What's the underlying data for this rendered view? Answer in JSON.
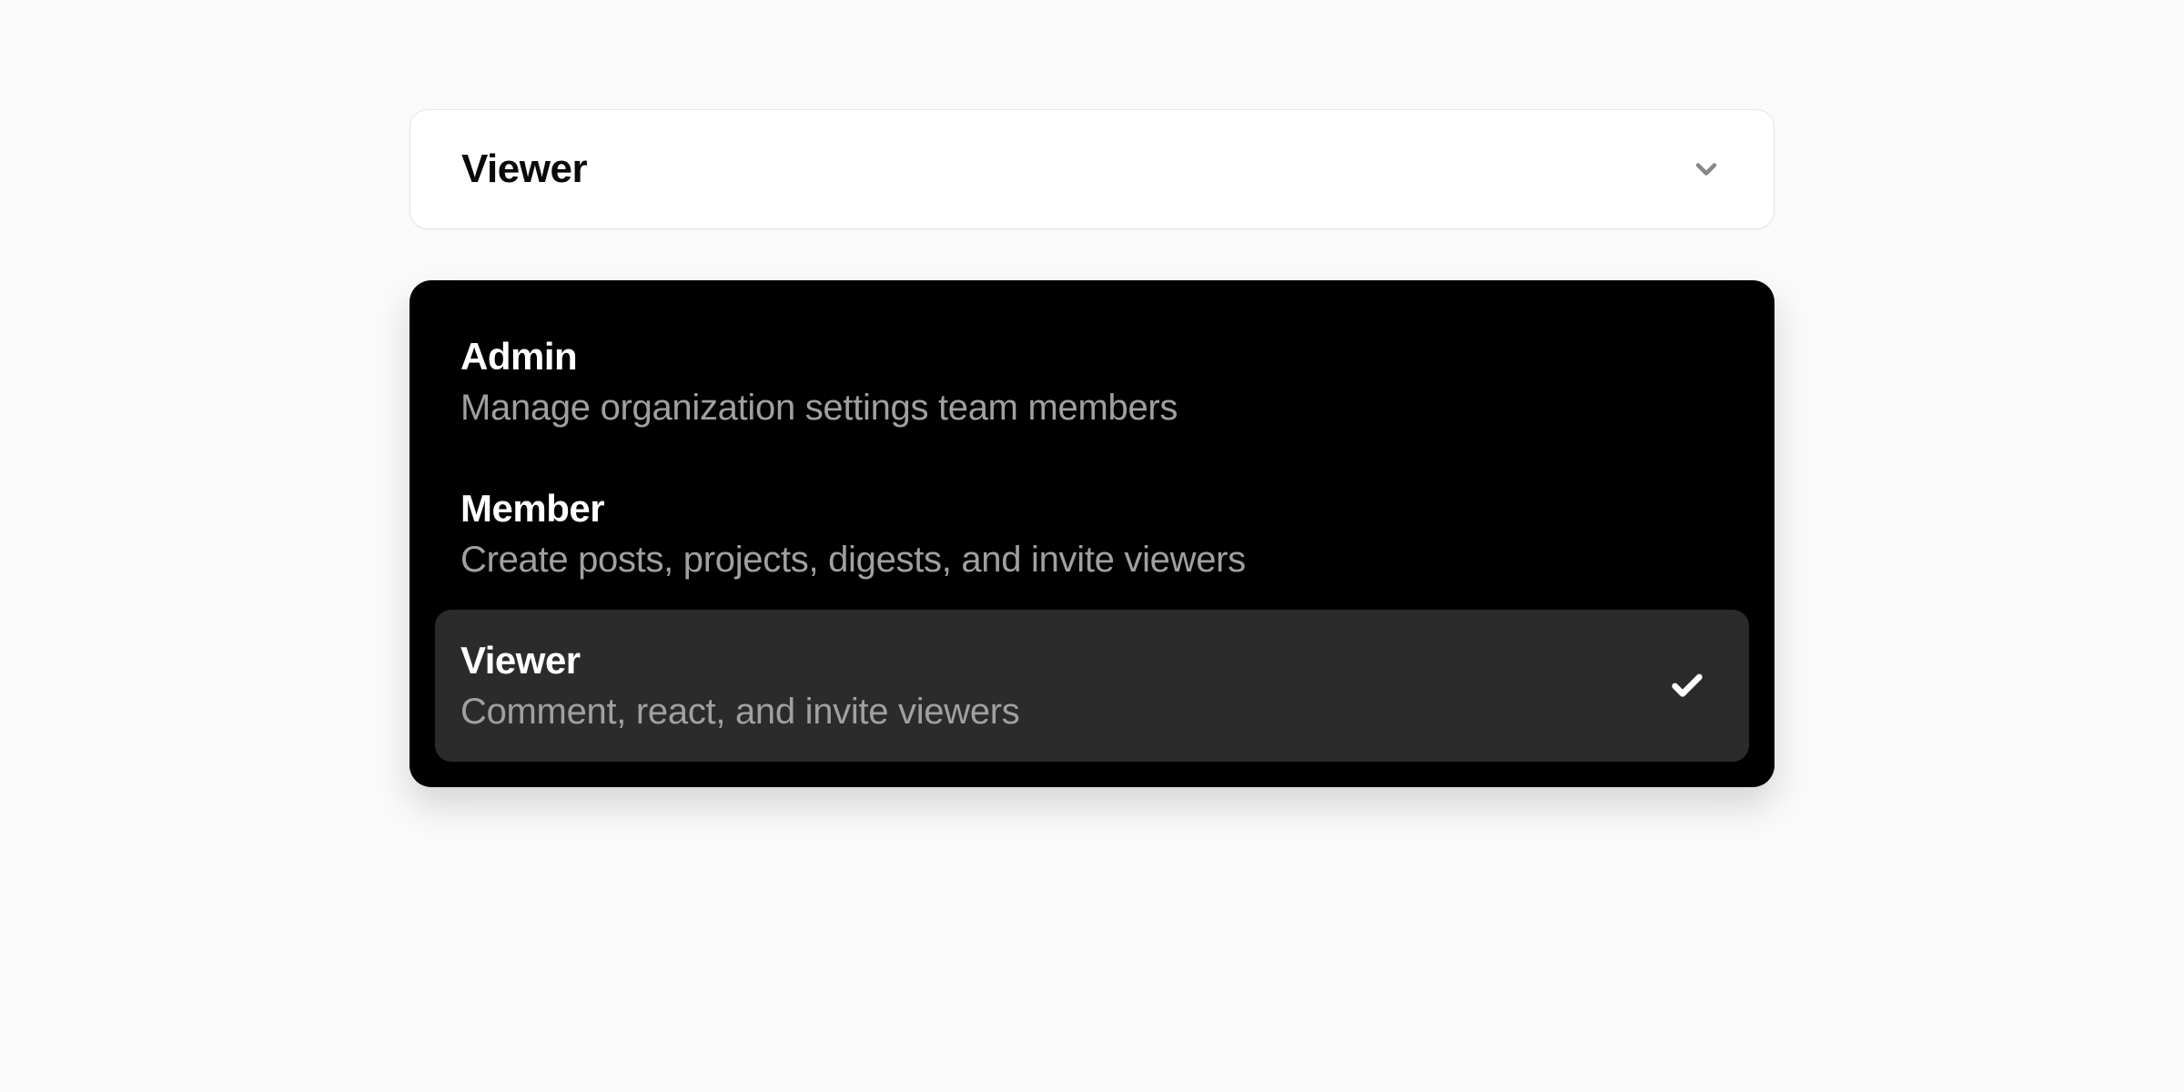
{
  "select": {
    "current_value": "Viewer"
  },
  "options": [
    {
      "title": "Admin",
      "description": "Manage organization settings team members",
      "selected": false
    },
    {
      "title": "Member",
      "description": "Create posts, projects, digests, and invite viewers",
      "selected": false
    },
    {
      "title": "Viewer",
      "description": "Comment, react, and invite viewers",
      "selected": true
    }
  ]
}
